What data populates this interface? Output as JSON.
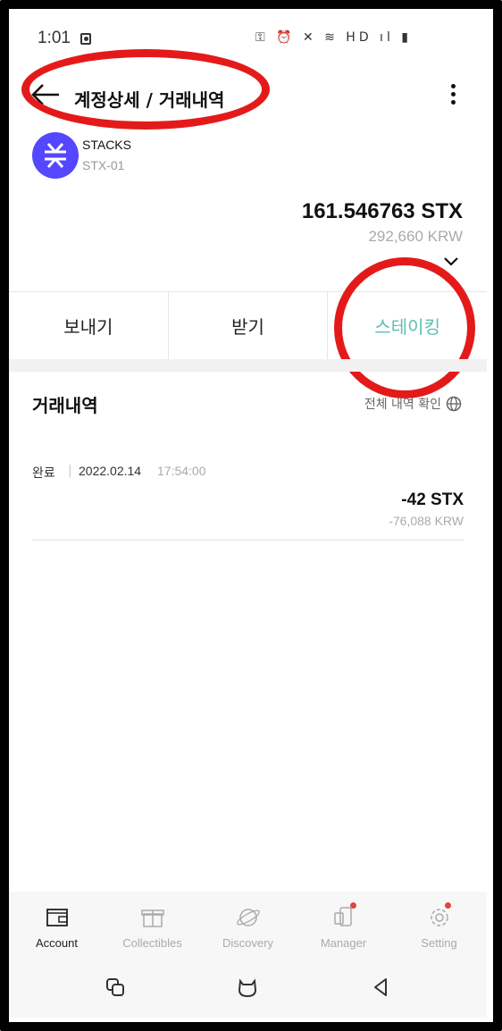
{
  "status_bar": {
    "time": "1:01",
    "icons_text": "⚿ ⏰ ✕ ≋ HD ıl ▮"
  },
  "header": {
    "title": "계정상세 / 거래내역"
  },
  "asset": {
    "name": "STACKS",
    "account": "STX-01",
    "balance": "161.546763 STX",
    "balance_fiat": "292,660 KRW",
    "logo_color": "#5546ff"
  },
  "actions": [
    {
      "label": "보내기"
    },
    {
      "label": "받기"
    },
    {
      "label": "스테이킹"
    }
  ],
  "history": {
    "title": "거래내역",
    "view_all": "전체 내역 확인",
    "transactions": [
      {
        "status": "완료",
        "date": "2022.02.14",
        "time": "17:54:00",
        "amount": "-42 STX",
        "amount_fiat": "-76,088 KRW"
      }
    ]
  },
  "bottom_nav": {
    "items": [
      {
        "label": "Account",
        "icon": "wallet-icon",
        "active": true
      },
      {
        "label": "Collectibles",
        "icon": "gift-box-icon",
        "active": false
      },
      {
        "label": "Discovery",
        "icon": "planet-icon",
        "active": false
      },
      {
        "label": "Manager",
        "icon": "device-icon",
        "active": false,
        "badge": true
      },
      {
        "label": "Setting",
        "icon": "gear-icon",
        "active": false,
        "badge": true
      }
    ]
  },
  "colors": {
    "accent_teal": "#5dbfb0",
    "annotation_red": "#e41a1a",
    "badge_red": "#e0463a"
  }
}
